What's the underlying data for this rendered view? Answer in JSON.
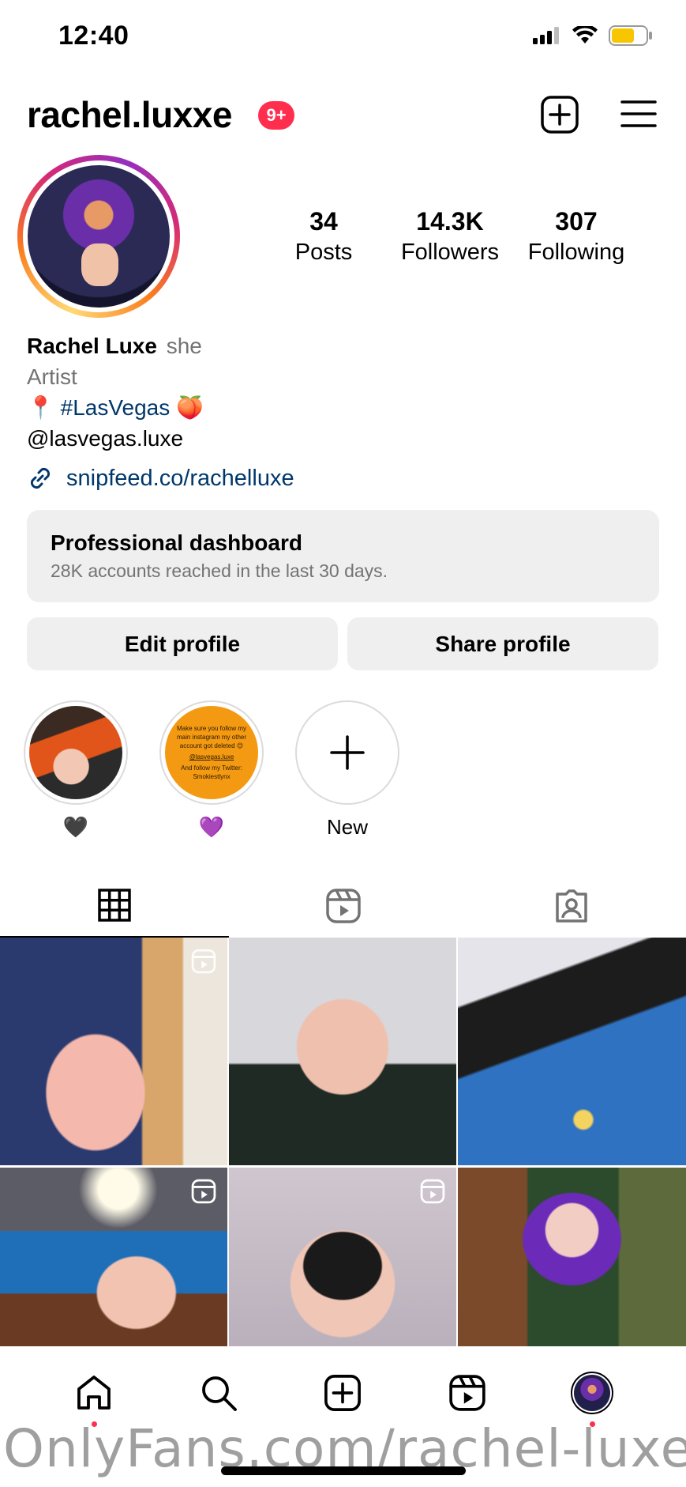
{
  "status_bar": {
    "time": "12:40",
    "battery_color": "#f7c600"
  },
  "header": {
    "username": "rachel.luxxe",
    "notification_badge": "9+"
  },
  "profile": {
    "stats": [
      {
        "value": "34",
        "label": "Posts"
      },
      {
        "value": "14.3K",
        "label": "Followers"
      },
      {
        "value": "307",
        "label": "Following"
      }
    ],
    "name": "Rachel Luxe",
    "pronoun": "she",
    "category": "Artist",
    "location_emoji": "📍",
    "hashtag": "#LasVegas",
    "peach_emoji": "🍑",
    "mention": "@lasvegas.luxe",
    "link": "snipfeed.co/rachelluxe"
  },
  "dashboard": {
    "title": "Professional dashboard",
    "subtitle": "28K accounts reached in the last 30 days."
  },
  "buttons": {
    "edit": "Edit profile",
    "share": "Share profile"
  },
  "highlights": [
    {
      "label": "🖤"
    },
    {
      "label": "💜",
      "text_lines": [
        "Make sure you follow my",
        "main instagram my other",
        "account got deleted 😊",
        "@lasvegas.luxe",
        "And follow my Twitter:",
        "Smokiestlynx"
      ]
    },
    {
      "label": "New"
    }
  ],
  "tabs": [
    "grid-icon",
    "reels-icon",
    "tagged-icon"
  ],
  "nav": [
    "home-icon",
    "search-icon",
    "create-icon",
    "reels-icon",
    "profile-avatar"
  ],
  "watermark": "OnlyFans.com/rachel-luxe",
  "colors": {
    "accent_red": "#ff2e4e",
    "link_blue": "#00376b",
    "gray_button": "#efefef"
  }
}
